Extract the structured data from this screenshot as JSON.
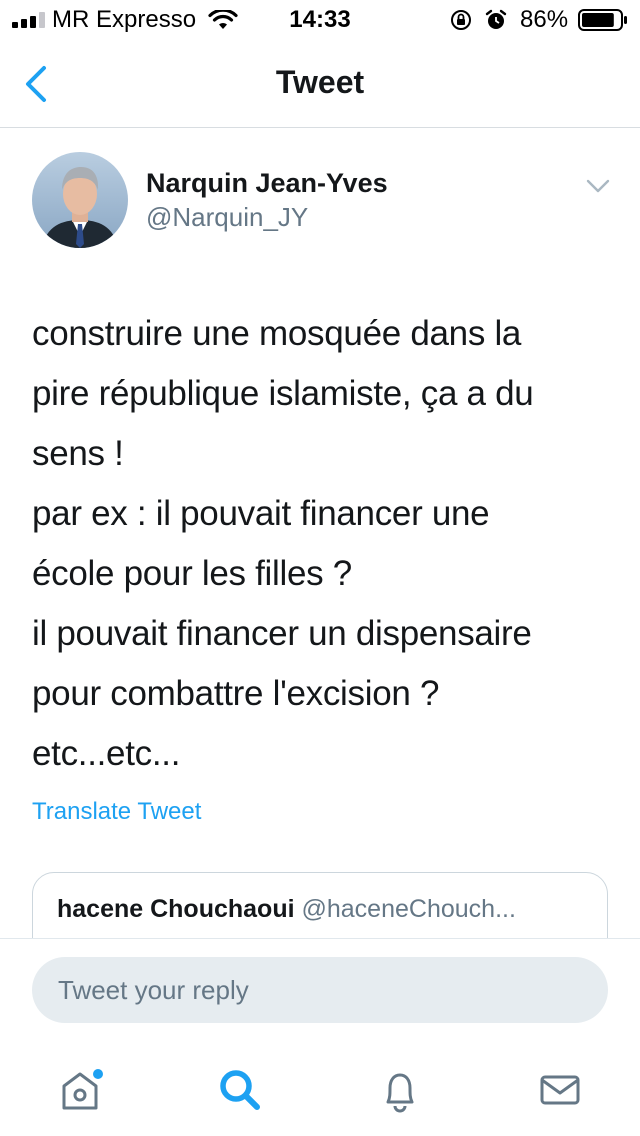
{
  "status_bar": {
    "carrier": "MR Expresso",
    "time": "14:33",
    "battery_percent": "86%",
    "battery_level": 0.86,
    "signal_bars": 3
  },
  "header": {
    "title": "Tweet",
    "back_icon": "chevron-left-icon"
  },
  "tweet": {
    "author_name": "Narquin Jean-Yves",
    "author_handle": "@Narquin_JY",
    "lines": [
      "construire une mosquée dans la",
      "pire république islamiste, ça a du",
      "sens !",
      "par ex : il pouvait financer une",
      "école pour les filles ?",
      "il pouvait financer un dispensaire",
      "pour combattre l'excision ?",
      "etc...etc..."
    ],
    "translate_label": "Translate Tweet"
  },
  "quoted_tweet": {
    "author_name": "hacene Chouchaoui",
    "author_handle": "@haceneChouch..."
  },
  "reply": {
    "placeholder": "Tweet your reply"
  },
  "tab_bar": {
    "icons": [
      "home-icon",
      "search-icon",
      "notifications-icon",
      "messages-icon"
    ],
    "active": "search-icon"
  },
  "colors": {
    "accent": "#1da1f2",
    "text_primary": "#14171a",
    "text_secondary": "#657786",
    "input_bg": "#e6ecf0",
    "divider": "#d8dde1"
  }
}
